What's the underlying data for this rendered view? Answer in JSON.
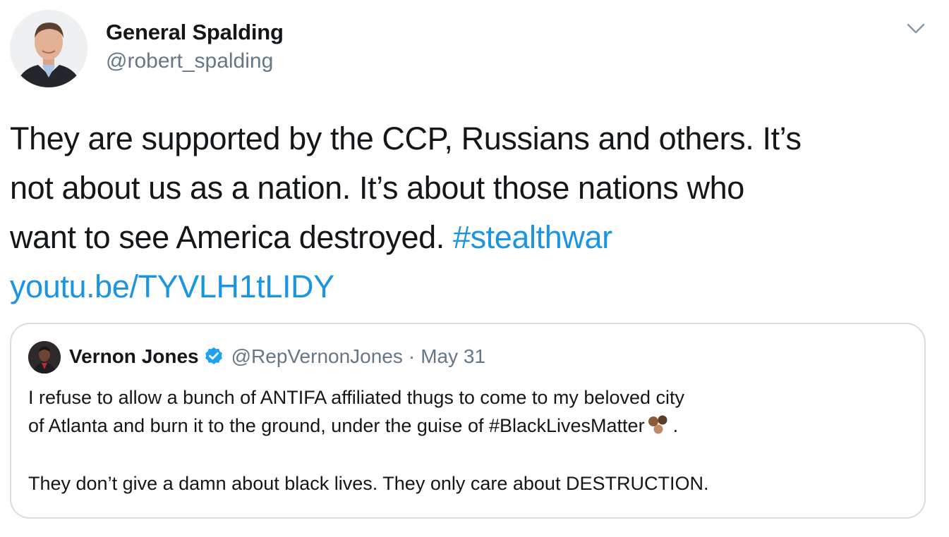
{
  "author": {
    "name": "General Spalding",
    "handle": "@robert_spalding"
  },
  "tweet": {
    "text_line_1": "They are supported by the CCP, Russians and others. It’s",
    "text_line_2": "not about us as a nation. It’s about those nations who",
    "text_line_3": "want to see America destroyed.",
    "hashtag": "#stealthwar",
    "link": "youtu.be/TYVLH1tLIDY"
  },
  "quoted_tweet": {
    "author_name": "Vernon Jones",
    "author_handle": "@RepVernonJones",
    "separator": "·",
    "date": "May 31",
    "text_line_1": "I refuse to allow a bunch of ANTIFA affiliated thugs to come to my beloved city",
    "text_line_2": "of Atlanta and burn it to the ground, under the guise of #BlackLivesMatter",
    "text_line_2_end": ".",
    "text_line_3": "They don’t give a damn about black lives. They only care about DESTRUCTION."
  },
  "icons": {
    "menu": "chevron-down-icon",
    "verified": "verified-badge-icon",
    "emoji": "raised-fists-emoji"
  },
  "colors": {
    "link": "#1b95e0",
    "secondary_text": "#657786",
    "border": "#d6dde3",
    "verified": "#1da1f2"
  }
}
